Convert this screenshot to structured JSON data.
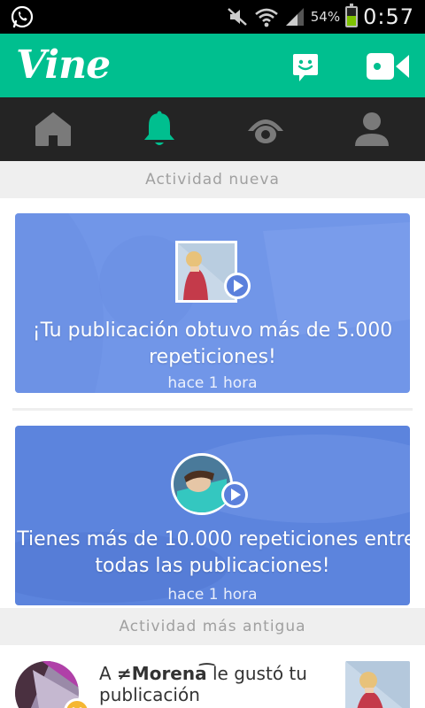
{
  "status_bar": {
    "battery_percent_label": "54%",
    "battery_level": 0.54,
    "time": "0:57",
    "icons": [
      "whatsapp-icon",
      "mute-icon",
      "wifi-icon",
      "signal-icon",
      "battery-icon"
    ]
  },
  "app_bar": {
    "logo": "Vine",
    "accent_color": "#00bf8f",
    "actions": [
      "messages-icon",
      "camera-icon"
    ]
  },
  "tabs": [
    {
      "name": "home",
      "icon": "home-icon",
      "active": false
    },
    {
      "name": "activity",
      "icon": "bell-icon",
      "active": true
    },
    {
      "name": "explore",
      "icon": "eye-icon",
      "active": false
    },
    {
      "name": "profile",
      "icon": "person-icon",
      "active": false
    }
  ],
  "sections": {
    "new": "Actividad nueva",
    "old": "Actividad más antigua"
  },
  "cards": [
    {
      "title_line1": "¡Tu publicación obtuvo más de 5.000",
      "title_line2": "repeticiones!",
      "time": "hace 1 hora",
      "color": "#7196e8"
    },
    {
      "title_line1": "¡Tienes más de 10.000 repeticiones entre",
      "title_line2": "todas las publicaciones!",
      "time": "hace 1 hora",
      "color": "#5c84dd"
    }
  ],
  "activity": [
    {
      "prefix": "A",
      "user": "≠Morena͡",
      "suffix": "le gustó tu",
      "line2": "publicación"
    }
  ]
}
